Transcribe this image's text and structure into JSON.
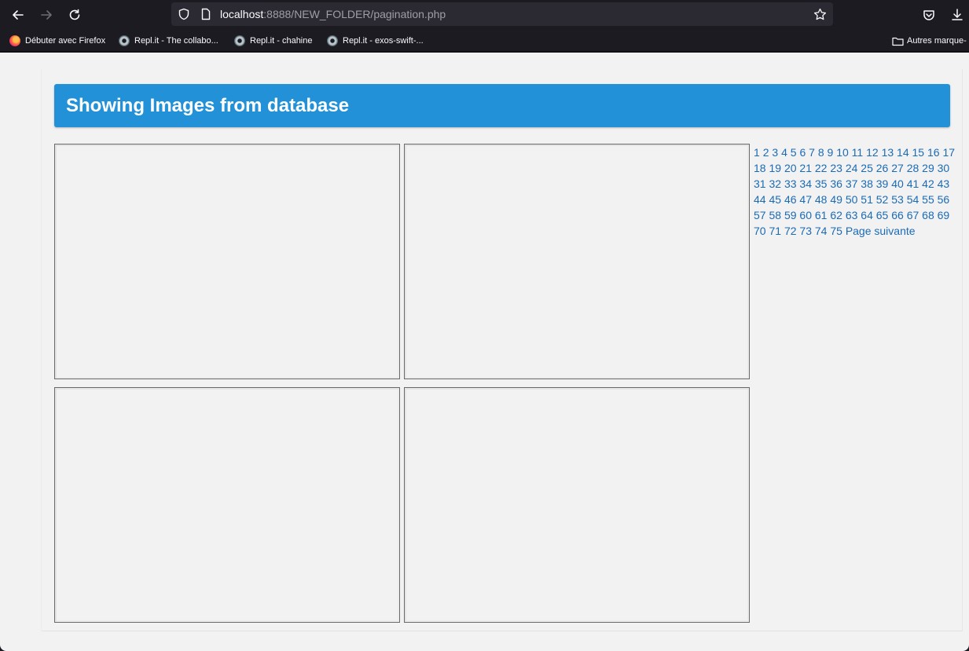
{
  "browser": {
    "url_host": "localhost",
    "url_rest": ":8888/NEW_FOLDER/pagination.php",
    "bookmarks": [
      {
        "label": "Débuter avec Firefox",
        "icon": "firefox-icon"
      },
      {
        "label": "Repl.it - The collabo...",
        "icon": "replit-icon"
      },
      {
        "label": "Repl.it - chahine",
        "icon": "replit-icon"
      },
      {
        "label": "Repl.it - exos-swift-...",
        "icon": "replit-icon"
      }
    ],
    "other_bookmarks": "Autres marque-"
  },
  "page": {
    "title": "Showing Images from database",
    "pages": [
      "1",
      "2",
      "3",
      "4",
      "5",
      "6",
      "7",
      "8",
      "9",
      "10",
      "11",
      "12",
      "13",
      "14",
      "15",
      "16",
      "17",
      "18",
      "19",
      "20",
      "21",
      "22",
      "23",
      "24",
      "25",
      "26",
      "27",
      "28",
      "29",
      "30",
      "31",
      "32",
      "33",
      "34",
      "35",
      "36",
      "37",
      "38",
      "39",
      "40",
      "41",
      "42",
      "43",
      "44",
      "45",
      "46",
      "47",
      "48",
      "49",
      "50",
      "51",
      "52",
      "53",
      "54",
      "55",
      "56",
      "57",
      "58",
      "59",
      "60",
      "61",
      "62",
      "63",
      "64",
      "65",
      "66",
      "67",
      "68",
      "69",
      "70",
      "71",
      "72",
      "73",
      "74",
      "75"
    ],
    "next_label": "Page suivante"
  },
  "colors": {
    "header": "#2391d7",
    "link": "#1a6bb6"
  }
}
